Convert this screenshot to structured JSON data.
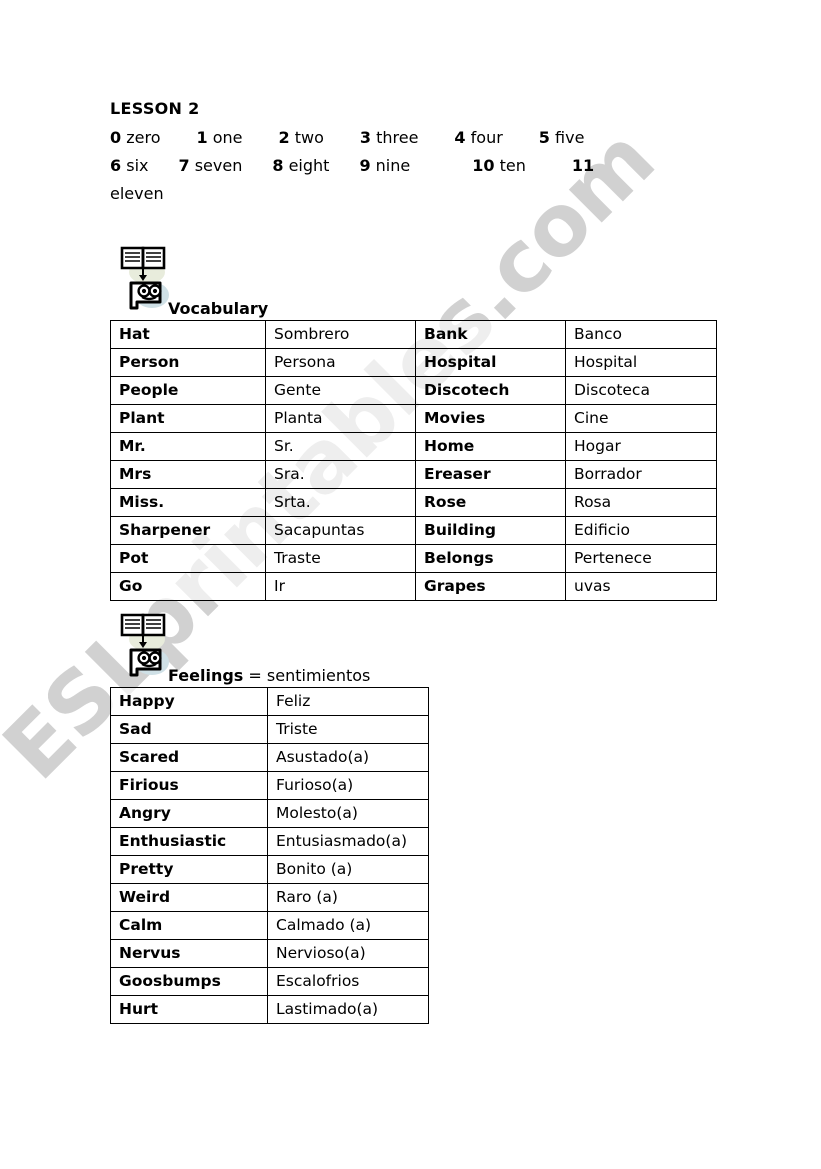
{
  "watermark": {
    "text": "ESLprintables.com",
    "color": "#c9c9c9"
  },
  "header": {
    "lesson_title": "LESSON 2",
    "numbers": [
      {
        "digit": "0",
        "word": "zero"
      },
      {
        "digit": "1",
        "word": "one"
      },
      {
        "digit": "2",
        "word": "two"
      },
      {
        "digit": "3",
        "word": "three"
      },
      {
        "digit": "4",
        "word": "four"
      },
      {
        "digit": "5",
        "word": "five"
      },
      {
        "digit": "6",
        "word": "six"
      },
      {
        "digit": "7",
        "word": "seven"
      },
      {
        "digit": "8",
        "word": "eight"
      },
      {
        "digit": "9",
        "word": "nine"
      },
      {
        "digit": "10",
        "word": "ten"
      },
      {
        "digit": "11",
        "word": "eleven"
      }
    ]
  },
  "vocabulary": {
    "icon": "open-book-speech-bubble-icon",
    "heading": "Vocabulary",
    "heading_suffix": "",
    "rows": [
      {
        "en1": "Hat",
        "es1": "Sombrero",
        "en2": "Bank",
        "es2": "Banco"
      },
      {
        "en1": "Person",
        "es1": "Persona",
        "en2": "Hospital",
        "es2": "Hospital"
      },
      {
        "en1": "People",
        "es1": "Gente",
        "en2": "Discotech",
        "es2": "Discoteca"
      },
      {
        "en1": "Plant",
        "es1": "Planta",
        "en2": "Movies",
        "es2": "Cine"
      },
      {
        "en1": "Mr.",
        "es1": "Sr.",
        "en2": "Home",
        "es2": "Hogar"
      },
      {
        "en1": "Mrs",
        "es1": "Sra.",
        "en2": "Ereaser",
        "es2": "Borrador"
      },
      {
        "en1": "Miss.",
        "es1": "Srta.",
        "en2": "Rose",
        "es2": "Rosa"
      },
      {
        "en1": "Sharpener",
        "es1": "Sacapuntas",
        "en2": "Building",
        "es2": "Edificio"
      },
      {
        "en1": "Pot",
        "es1": "Traste",
        "en2": "Belongs",
        "es2": "Pertenece"
      },
      {
        "en1": "Go",
        "es1": "Ir",
        "en2": "Grapes",
        "es2": "uvas"
      }
    ]
  },
  "feelings": {
    "icon": "open-book-speech-bubble-icon",
    "heading": "Feelings",
    "heading_suffix": "= sentimientos",
    "rows": [
      {
        "en": "Happy",
        "es": "Feliz"
      },
      {
        "en": "Sad",
        "es": "Triste"
      },
      {
        "en": "Scared",
        "es": "Asustado(a)"
      },
      {
        "en": "Firious",
        "es": "Furioso(a)"
      },
      {
        "en": "Angry",
        "es": "Molesto(a)"
      },
      {
        "en": "Enthusiastic",
        "es": "Entusiasmado(a)"
      },
      {
        "en": "Pretty",
        "es": "Bonito (a)"
      },
      {
        "en": "Weird",
        "es": "Raro (a)"
      },
      {
        "en": "Calm",
        "es": "Calmado (a)"
      },
      {
        "en": "Nervus",
        "es": "Nervioso(a)"
      },
      {
        "en": "Goosbumps",
        "es": "Escalofrios"
      },
      {
        "en": "Hurt",
        "es": "Lastimado(a)"
      }
    ]
  }
}
